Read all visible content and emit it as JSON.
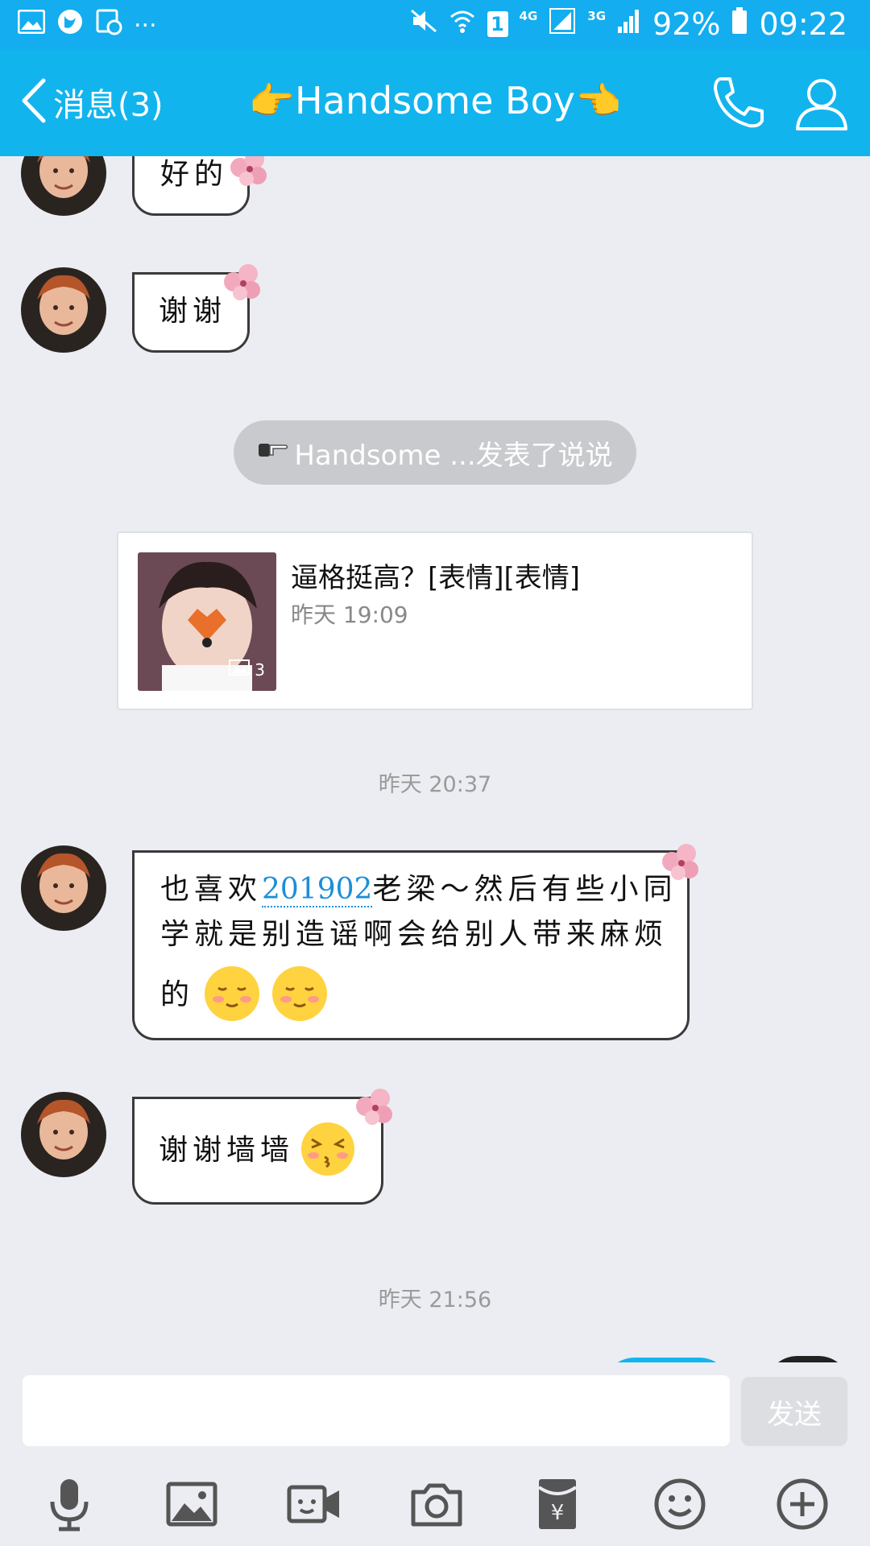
{
  "status_bar": {
    "network_1": "4G",
    "network_2": "3G",
    "battery_percent": "92%",
    "time": "09:22",
    "sim_slot": "1",
    "overflow": "..."
  },
  "header": {
    "back_label": "消息(3)",
    "title": "👉Handsome Boy👈"
  },
  "messages": [
    {
      "text": "好的"
    },
    {
      "text": "谢谢"
    }
  ],
  "system_notice": {
    "text": "Handsome ...发表了说说"
  },
  "post_card": {
    "title": "逼格挺高？[表情][表情]",
    "time": "昨天 19:09",
    "image_count": "3"
  },
  "timestamps": [
    "昨天 20:37",
    "昨天 21:56"
  ],
  "long_message": {
    "line1_before": "也喜欢",
    "link": "201902",
    "line1_after": "老梁～然后有些小同",
    "line2": "学就是别造谣啊会给别人带来麻烦",
    "line3": "的"
  },
  "last_message": {
    "text": "谢谢墙墙"
  },
  "composer": {
    "input_value": "",
    "send_label": "发送"
  },
  "toolbar_icons": [
    "mic-icon",
    "image-icon",
    "video-icon",
    "camera-icon",
    "red-packet-icon",
    "emoji-icon",
    "plus-icon"
  ],
  "colors": {
    "accent": "#12b4ee",
    "link": "#1b8fd8",
    "background": "#ebedf2"
  }
}
